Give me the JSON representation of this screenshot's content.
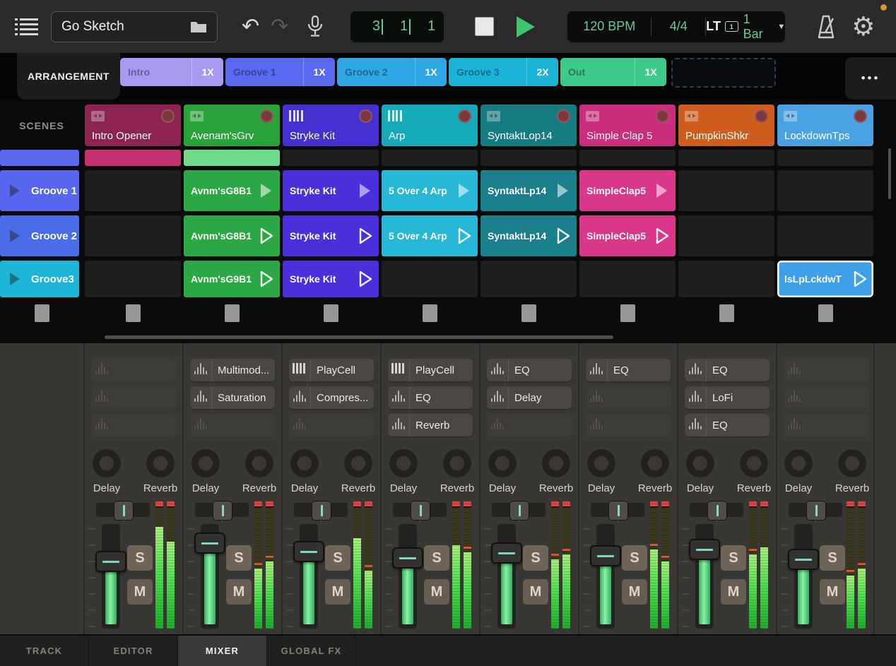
{
  "topbar": {
    "project_name": "Go Sketch",
    "position": {
      "bar": "3",
      "beat": "1",
      "sixteenth": "1"
    },
    "tempo_label": "120 BPM",
    "time_signature": "4/4",
    "latency_label": "LT",
    "loop_badge": "1",
    "quantize_label": "1 Bar",
    "icons": [
      "menu-icon",
      "folder-icon",
      "undo-icon",
      "redo-icon",
      "microphone-icon",
      "stop-icon",
      "play-icon",
      "metronome-icon",
      "gear-icon"
    ],
    "undo_glyph": "↶",
    "redo_glyph": "↷",
    "caret_glyph": "▼"
  },
  "colors": {
    "accent_green": "#6ac896",
    "play_green": "#3ec56b",
    "record_dot": "#7d383e",
    "meter_red": "#e04343",
    "fader_green": "#52d67e",
    "handle_teal": "#8cd9bd",
    "mic_indicator_orange": "#d79531"
  },
  "arrangement": {
    "label": "ARRANGEMENT",
    "more_label": "•••",
    "sections": [
      {
        "name": "Intro",
        "repeat": "1X",
        "color": "#a89af1"
      },
      {
        "name": "Groove 1",
        "repeat": "1X",
        "color": "#5a6af0"
      },
      {
        "name": "Groove 2",
        "repeat": "1X",
        "color": "#2fa7e4"
      },
      {
        "name": "Groove 3",
        "repeat": "2X",
        "color": "#1bb3d8"
      },
      {
        "name": "Out",
        "repeat": "1X",
        "color": "#3cc98a"
      }
    ]
  },
  "scenes": {
    "label": "SCENES",
    "tracks": [
      {
        "name": "Intro Opener",
        "color": "#8d2351",
        "icon": "pad"
      },
      {
        "name": "Avenam'sGrv",
        "color": "#2aa33d",
        "icon": "pad"
      },
      {
        "name": "Stryke Kit",
        "color": "#4630cf",
        "icon": "keys"
      },
      {
        "name": "Arp",
        "color": "#16a9ba",
        "icon": "keys"
      },
      {
        "name": "SyntaktLop14",
        "color": "#177b82",
        "icon": "pad"
      },
      {
        "name": "Simple Clap 5",
        "color": "#cb2e7d",
        "icon": "pad"
      },
      {
        "name": "PumpkinShkr",
        "color": "#cf5d1d",
        "icon": "pad"
      },
      {
        "name": "LockdownTps",
        "color": "#4aa2e2",
        "icon": "pad"
      }
    ],
    "partial_row": {
      "scene_color": "#5a66ee",
      "cells": [
        {
          "color": "#c43170"
        },
        {
          "color": "#72da8c"
        },
        null,
        null,
        null,
        null,
        null,
        null
      ]
    },
    "rows": [
      {
        "name": "Groove 1",
        "color": "#5866ef",
        "height": "row-scene",
        "cells": [
          null,
          {
            "label": "Avnm'sG8B1",
            "color": "#2ba845",
            "tri": "solid"
          },
          {
            "label": "Stryke Kit",
            "color": "#4a30da",
            "tri": "solid"
          },
          {
            "label": "5 Over 4 Arp",
            "color": "#27b8d8",
            "tri": "solid"
          },
          {
            "label": "SyntaktLp14",
            "color": "#1b7f8c",
            "tri": "solid"
          },
          {
            "label": "SimpleClap5",
            "color": "#d93789",
            "tri": "solid"
          },
          null,
          null
        ]
      },
      {
        "name": "Groove 2",
        "color": "#4b6ce8",
        "height": "row-scene",
        "cells": [
          null,
          {
            "label": "Avnm'sG8B1",
            "color": "#2ba845",
            "tri": "outline"
          },
          {
            "label": "Stryke Kit",
            "color": "#4a30da",
            "tri": "outline"
          },
          {
            "label": "5 Over 4 Arp",
            "color": "#27b8d8",
            "tri": "outline"
          },
          {
            "label": "SyntaktLp14",
            "color": "#1b7f8c",
            "tri": "outline"
          },
          {
            "label": "SimpleClap5",
            "color": "#d93789",
            "tri": "outline"
          },
          null,
          null
        ]
      },
      {
        "name": "Groove3",
        "color": "#1db6d9",
        "height": "row-cut",
        "cells": [
          null,
          {
            "label": "Avnm'sG9B1",
            "color": "#2ba845",
            "tri": "outline"
          },
          {
            "label": "Stryke Kit",
            "color": "#4a30da",
            "tri": "outline"
          },
          null,
          null,
          null,
          null,
          {
            "label": "IsLpLckdwT",
            "color": "#3f9fe8",
            "tri": "outline",
            "selected": true
          }
        ]
      }
    ]
  },
  "mixer": {
    "send_knob_labels": [
      "Delay",
      "Reverb"
    ],
    "solo_label": "S",
    "mute_label": "M",
    "channels": [
      {
        "fx": [
          null,
          null,
          null
        ],
        "fader": 0.32,
        "meters": [
          0.88,
          0.75
        ]
      },
      {
        "fx": [
          {
            "label": "Multimod...",
            "icon": "wave"
          },
          {
            "label": "Saturation",
            "icon": "wave"
          },
          null
        ],
        "fader": 0.1,
        "meters": [
          0.52,
          0.58
        ]
      },
      {
        "fx": [
          {
            "label": "PlayCell",
            "icon": "keys"
          },
          {
            "label": "Compres...",
            "icon": "wave"
          },
          null
        ],
        "fader": 0.2,
        "meters": [
          0.78,
          0.5
        ]
      },
      {
        "fx": [
          {
            "label": "PlayCell",
            "icon": "keys"
          },
          {
            "label": "EQ",
            "icon": "wave"
          },
          {
            "label": "Reverb",
            "icon": "wave"
          }
        ],
        "fader": 0.28,
        "meters": [
          0.72,
          0.66
        ]
      },
      {
        "fx": [
          {
            "label": "EQ",
            "icon": "wave"
          },
          {
            "label": "Delay",
            "icon": "wave"
          },
          null
        ],
        "fader": 0.22,
        "meters": [
          0.6,
          0.64
        ]
      },
      {
        "fx": [
          {
            "label": "EQ",
            "icon": "wave"
          },
          null,
          null
        ],
        "fader": 0.25,
        "meters": [
          0.68,
          0.58
        ]
      },
      {
        "fx": [
          {
            "label": "EQ",
            "icon": "wave"
          },
          {
            "label": "LoFi",
            "icon": "wave"
          },
          {
            "label": "EQ",
            "icon": "wave"
          }
        ],
        "fader": 0.18,
        "meters": [
          0.64,
          0.7
        ]
      },
      {
        "fx": [
          null,
          null,
          null
        ],
        "fader": 0.3,
        "meters": [
          0.46,
          0.52
        ]
      }
    ]
  },
  "bottom_tabs": [
    {
      "label": "TRACK",
      "active": false
    },
    {
      "label": "EDITOR",
      "active": false
    },
    {
      "label": "MIXER",
      "active": true
    },
    {
      "label": "GLOBAL FX",
      "active": false
    }
  ]
}
